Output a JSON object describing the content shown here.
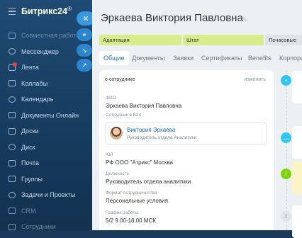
{
  "app": {
    "logo": "Битрикс24",
    "logo_mark": "®"
  },
  "sidebar": {
    "items": [
      {
        "label": "Совместная работа",
        "icon": "team-icon",
        "dim": true
      },
      {
        "label": "Мессенджер",
        "icon": "chat-icon"
      },
      {
        "label": "Лента",
        "icon": "feed-icon",
        "badge": true
      },
      {
        "label": "Коллабы",
        "icon": "collab-icon"
      },
      {
        "label": "Календарь",
        "icon": "calendar-icon"
      },
      {
        "label": "Документы Онлайн",
        "icon": "documents-icon"
      },
      {
        "label": "Доски",
        "icon": "boards-icon"
      },
      {
        "label": "Диск",
        "icon": "disk-icon"
      },
      {
        "label": "Почта",
        "icon": "mail-icon"
      },
      {
        "label": "Группы",
        "icon": "groups-icon"
      },
      {
        "label": "Задачи и Проекты",
        "icon": "tasks-icon"
      },
      {
        "label": "CRM",
        "icon": "crm-icon",
        "dim": true
      },
      {
        "label": "Сотрудники",
        "icon": "employees-icon",
        "dim": true
      }
    ]
  },
  "float_buttons": {
    "close": "✕",
    "link": "⚭",
    "minimize": "↘",
    "open_new": "↗"
  },
  "panel": {
    "title": "Эркаева Виктория Павловна",
    "stages": [
      {
        "label": "Адаптация",
        "color": "#d7ec8b"
      },
      {
        "label": "Штат",
        "color": "#d7ec8b"
      },
      {
        "label": "Почасовые",
        "color": "#dfe3e8"
      }
    ],
    "tabs": [
      "Общие",
      "Документы",
      "Заявки",
      "Сертификаты",
      "Benefits",
      "Корпора"
    ],
    "active_tab": "Общие"
  },
  "card": {
    "heading": "о сотруднике",
    "edit_link": "изменить",
    "fields": {
      "fio_label": "ФИО",
      "fio_value": "Эркаева Виктория Павловна",
      "b24_label": "Сотрудник в Б24",
      "user_name": "Виктория Эркаева",
      "user_position": "Руководитель отдела Аналитики",
      "company_label": "ЮЛ",
      "company_value": "РФ ООО \"Атрикс\" Москва",
      "position_label": "Должность",
      "position_value": "Руководитель отдела аналитики",
      "employment_label": "Формат сотрудничества",
      "employment_value": "Персональные условия",
      "schedule_label": "График работы",
      "schedule_value": "5/2 9.00-18.00 МСК"
    }
  },
  "timeline": {
    "icons": [
      {
        "icon": "chat-bubble-icon",
        "color": "#2fc6f6",
        "glyph": "▪"
      },
      {
        "icon": "comment-icon",
        "color": "#2fc6f6",
        "glyph": "…"
      },
      {
        "icon": "info-icon",
        "color": "#7bd500",
        "glyph": "i"
      },
      {
        "icon": "info-outline-icon",
        "color": "#e0e4e8",
        "glyph": "i"
      }
    ]
  }
}
